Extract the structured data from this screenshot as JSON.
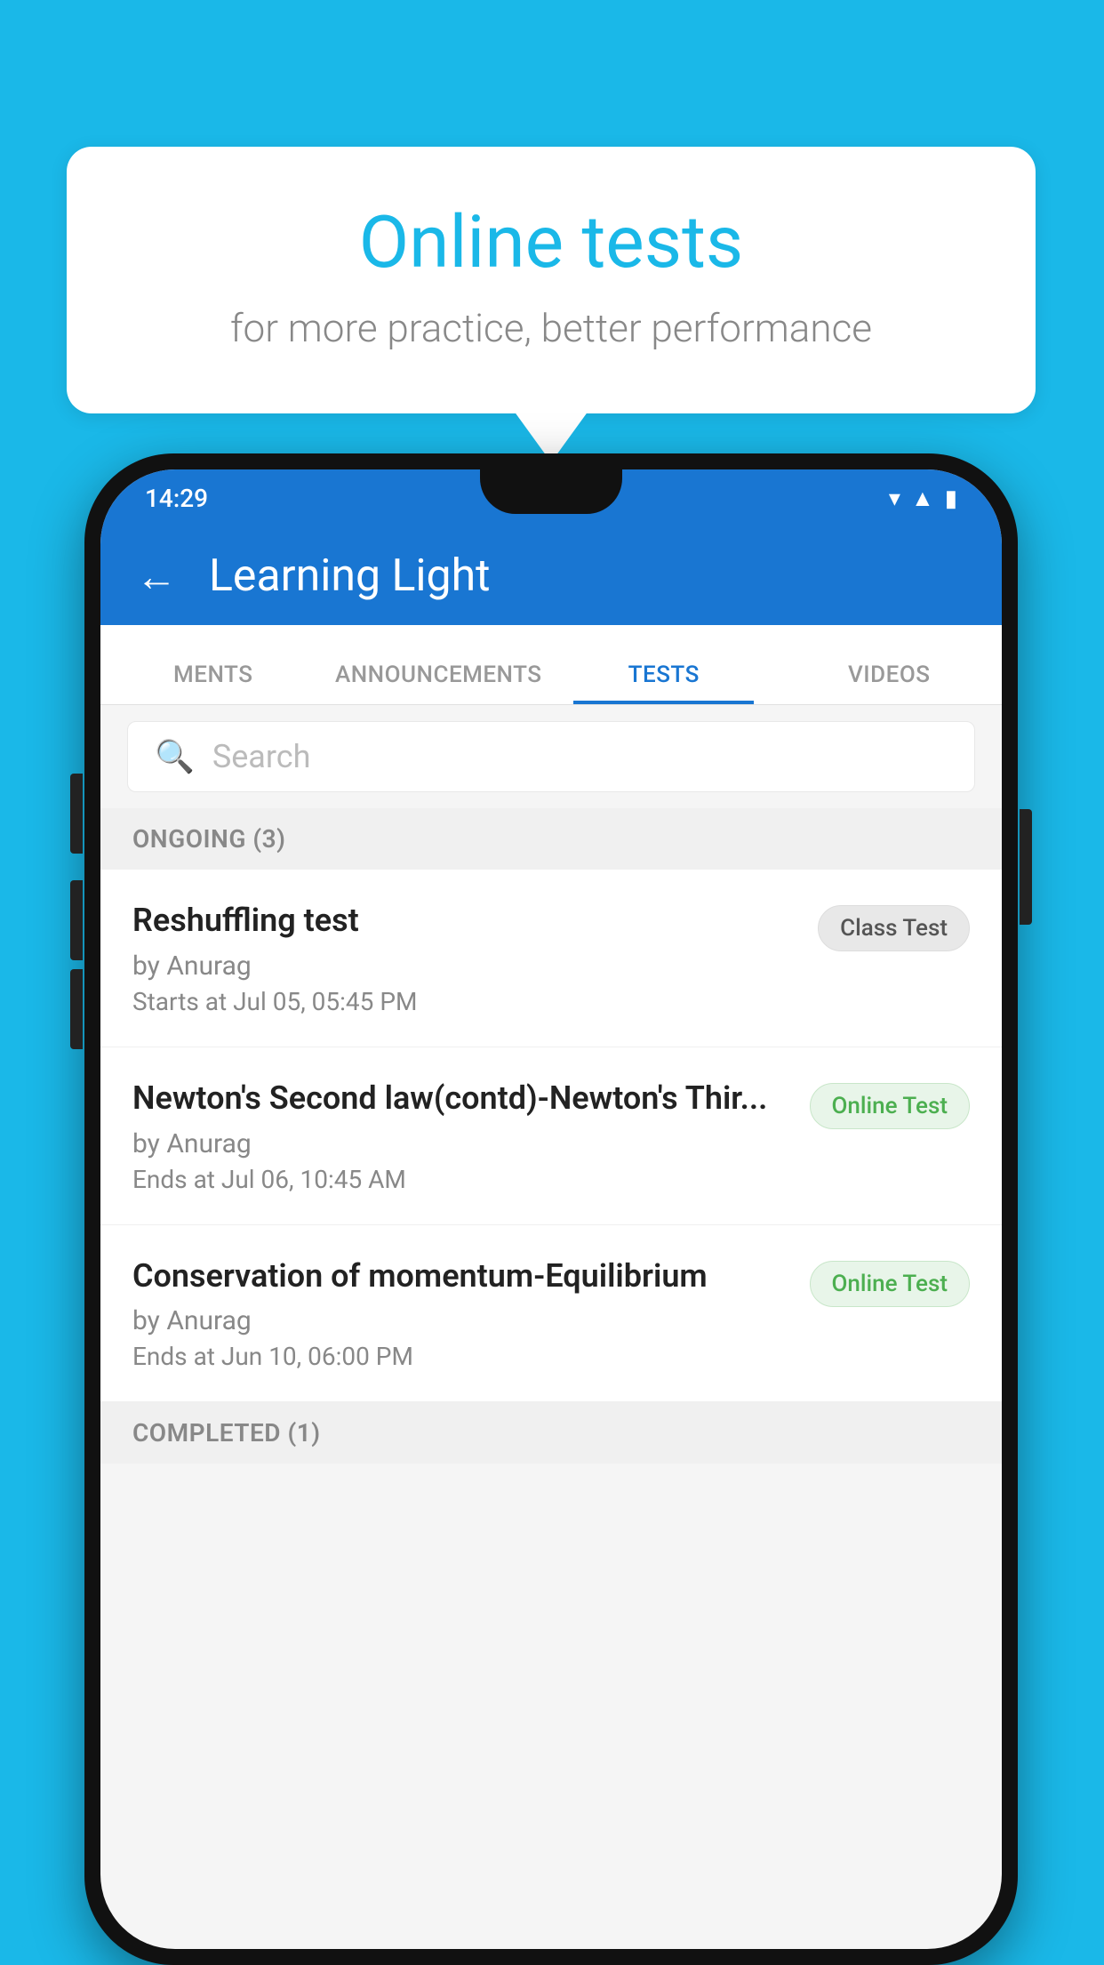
{
  "background": {
    "color": "#1ab8e8"
  },
  "speechBubble": {
    "title": "Online tests",
    "subtitle": "for more practice, better performance"
  },
  "phone": {
    "statusBar": {
      "time": "14:29",
      "icons": [
        "wifi",
        "signal",
        "battery"
      ]
    },
    "header": {
      "backLabel": "←",
      "title": "Learning Light"
    },
    "tabs": [
      {
        "label": "MENTS",
        "active": false
      },
      {
        "label": "ANNOUNCEMENTS",
        "active": false
      },
      {
        "label": "TESTS",
        "active": true
      },
      {
        "label": "VIDEOS",
        "active": false
      }
    ],
    "search": {
      "placeholder": "Search"
    },
    "sections": [
      {
        "header": "ONGOING (3)",
        "items": [
          {
            "name": "Reshuffling test",
            "by": "by Anurag",
            "date": "Starts at  Jul 05, 05:45 PM",
            "badge": "Class Test",
            "badgeType": "class"
          },
          {
            "name": "Newton's Second law(contd)-Newton's Thir...",
            "by": "by Anurag",
            "date": "Ends at  Jul 06, 10:45 AM",
            "badge": "Online Test",
            "badgeType": "online"
          },
          {
            "name": "Conservation of momentum-Equilibrium",
            "by": "by Anurag",
            "date": "Ends at  Jun 10, 06:00 PM",
            "badge": "Online Test",
            "badgeType": "online"
          }
        ]
      }
    ],
    "completedSection": {
      "header": "COMPLETED (1)"
    }
  }
}
